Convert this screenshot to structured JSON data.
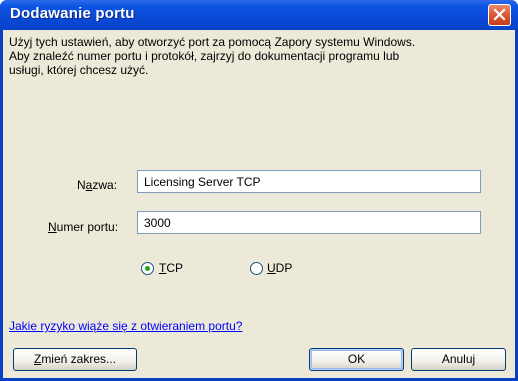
{
  "window": {
    "title": "Dodawanie portu"
  },
  "description": {
    "line1": "Użyj tych ustawień, aby otworzyć port za pomocą Zapory systemu Windows.",
    "line2": "Aby znaleźć numer portu i protokół, zajrzyj do dokumentacji programu lub",
    "line3": "usługi, której chcesz użyć."
  },
  "name": {
    "label_pre": "N",
    "label_key": "a",
    "label_post": "zwa:",
    "value": "Licensing Server TCP"
  },
  "port": {
    "label_key": "N",
    "label_post": "umer portu:",
    "value": "3000"
  },
  "protocol": {
    "tcp": {
      "key": "T",
      "rest": "CP",
      "selected": true
    },
    "udp": {
      "key": "U",
      "rest": "DP",
      "selected": false
    }
  },
  "risk_link": "Jakie ryzyko wiąże się z otwieraniem portu?",
  "buttons": {
    "scope": {
      "key": "Z",
      "rest": "mień zakres..."
    },
    "ok": "OK",
    "cancel": "Anuluj"
  },
  "colors": {
    "titlebar": "#0a49d6",
    "client": "#ece9d8",
    "link": "#0000ff",
    "radio_dot": "#21a121",
    "close": "#d9542f"
  }
}
